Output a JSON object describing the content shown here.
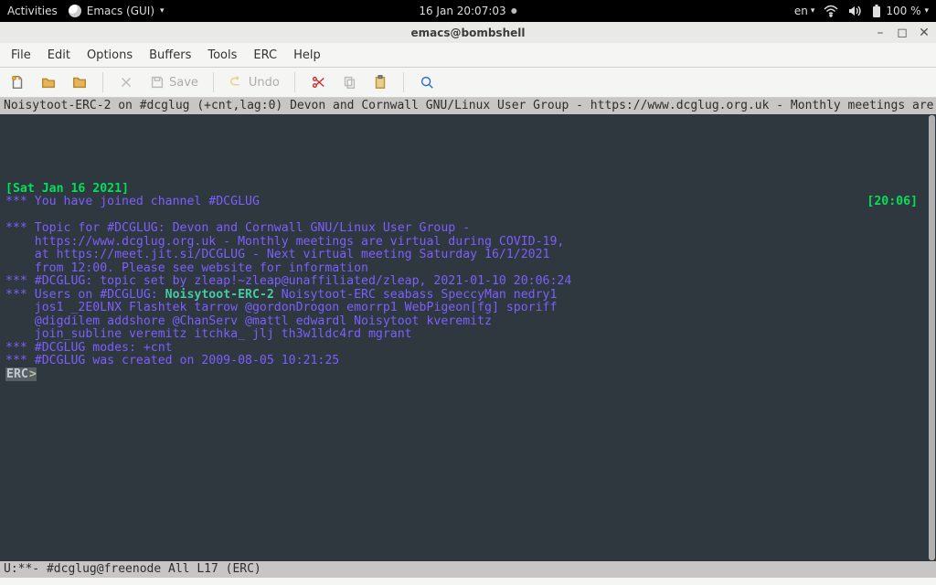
{
  "gnome_top": {
    "activities": "Activities",
    "app_name": "Emacs (GUI)",
    "clock": "16 Jan  20:07:03",
    "lang": "en",
    "battery": "100 %"
  },
  "window": {
    "title": "emacs@bombshell"
  },
  "menubar": {
    "items": [
      "File",
      "Edit",
      "Options",
      "Buffers",
      "Tools",
      "ERC",
      "Help"
    ]
  },
  "toolbar": {
    "save_label": "Save",
    "undo_label": "Undo"
  },
  "headerline": "Noisytoot-ERC-2 on #dcglug (+cnt,lag:0) Devon and Cornwall GNU/Linux User Group - https://www.dcglug.org.uk - Monthly meetings are virtual during",
  "erc": {
    "date_header": "[Sat Jan 16 2021]",
    "join_line": "*** You have joined channel #DCGLUG",
    "join_ts": "[20:06]",
    "topic1": "*** Topic for #DCGLUG: Devon and Cornwall GNU/Linux User Group -",
    "topic2": "    https://www.dcglug.org.uk - Monthly meetings are virtual during COVID-19,",
    "topic3": "    at https://meet.jit.si/DCGLUG - Next virtual meeting Saturday 16/1/2021",
    "topic4": "    from 12:00. Please see website for information",
    "topic_set": "*** #DCGLUG: topic set by zleap!~zleap@unaffiliated/zleap, 2021-01-10 20:06:24",
    "users_prefix": "*** Users on #DCGLUG: ",
    "my_nick": "Noisytoot-ERC-2",
    "users_rest1": " Noisytoot-ERC seabass SpeccyMan nedry1",
    "users2": "    jos1 _2E0LNX Flashtek tarrow @gordonDrogon emorrp1 WebPigeon[fg] sporiff",
    "users3": "    @digdilem addshore @ChanServ @mattl edwardl Noisytoot kveremitz",
    "users4": "    join_subline veremitz itchka_ jlj th3w1ldc4rd mgrant",
    "modes": "*** #DCGLUG modes: +cnt",
    "created": "*** #DCGLUG was created on 2009-08-05 10:21:25",
    "prompt_prefix": "ERC",
    "prompt_gt": ">"
  },
  "modeline": "U:**-  #dcglug@freenode   All L17     (ERC)"
}
